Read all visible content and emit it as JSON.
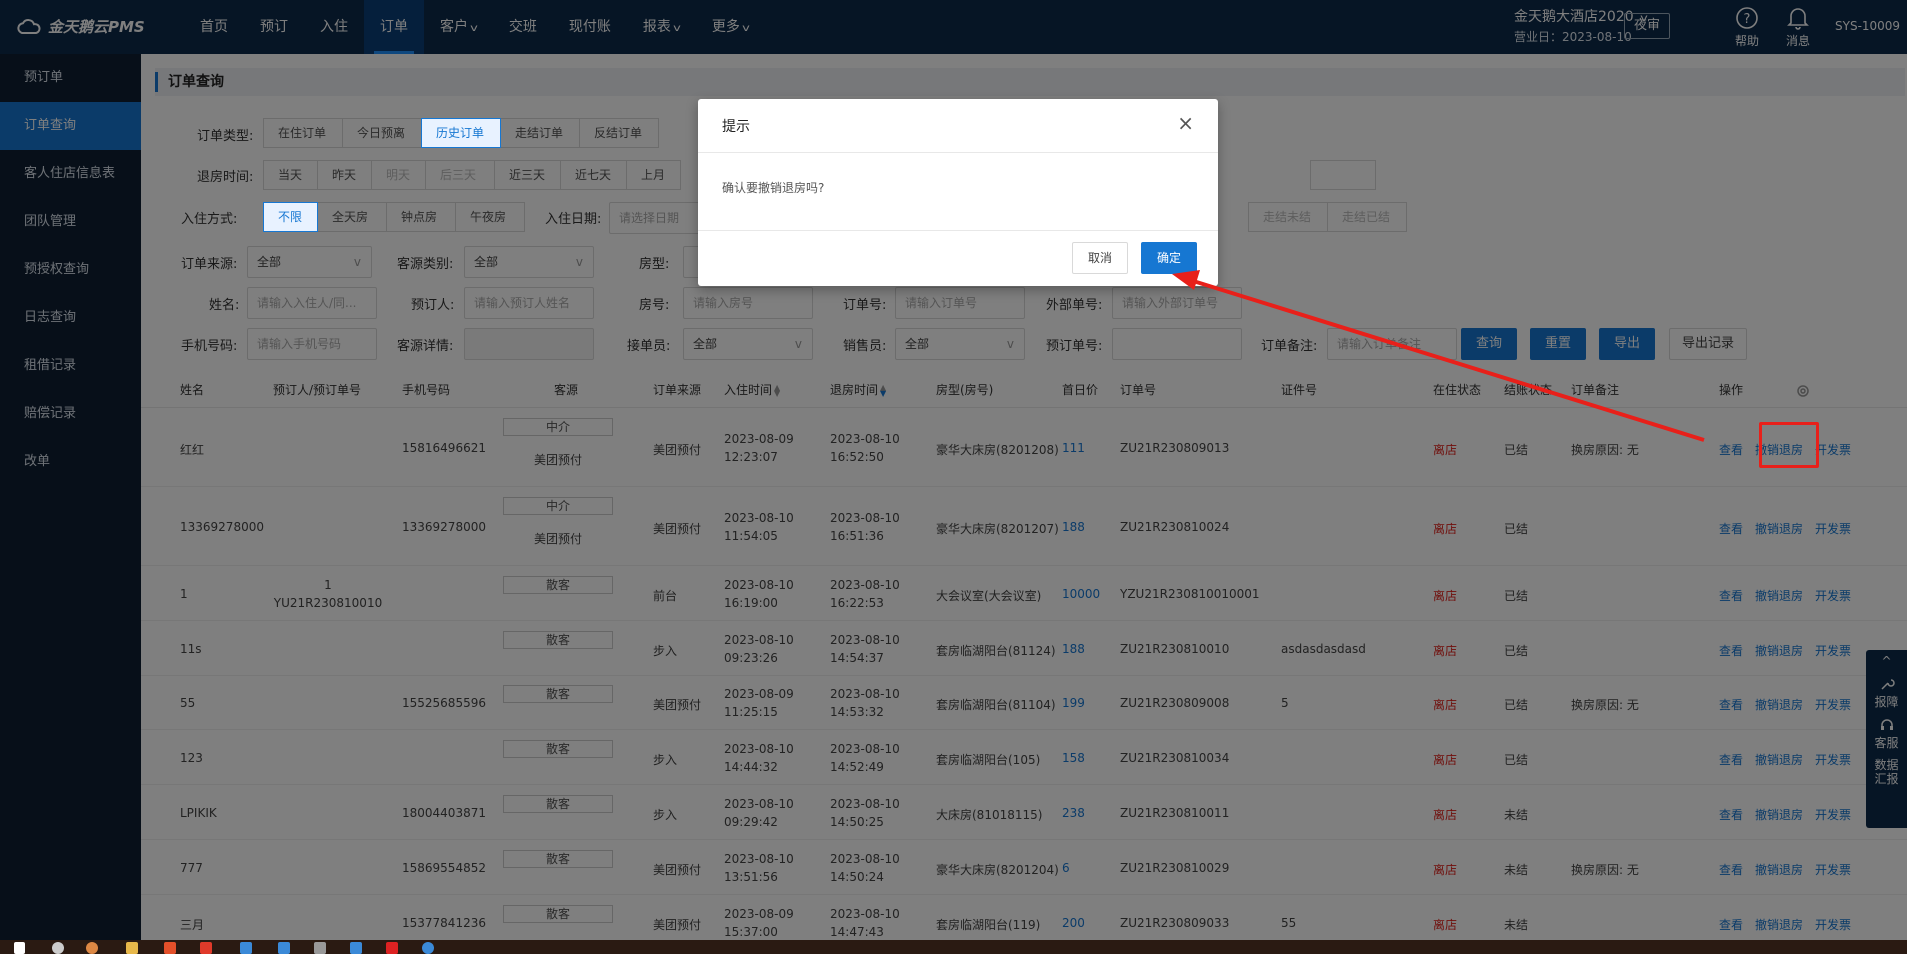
{
  "app": {
    "logo_text": "金天鹅云PMS",
    "nav": [
      {
        "label": "首页",
        "caret": false
      },
      {
        "label": "预订",
        "caret": false
      },
      {
        "label": "入住",
        "caret": false
      },
      {
        "label": "订单",
        "caret": false,
        "active": true
      },
      {
        "label": "客户",
        "caret": true
      },
      {
        "label": "交班",
        "caret": false
      },
      {
        "label": "现付账",
        "caret": false
      },
      {
        "label": "报表",
        "caret": true
      },
      {
        "label": "更多",
        "caret": true
      }
    ],
    "hotel_name": "金天鹅大酒店2020",
    "business_day": "营业日：2023-08-10",
    "night_audit": "夜审",
    "help": "帮助",
    "messages": "消息",
    "user": "SYS-10009",
    "caret_glyph": "v"
  },
  "sidebar": [
    "预订单",
    "订单查询",
    "客人住店信息表",
    "团队管理",
    "预授权查询",
    "日志查询",
    "租借记录",
    "赔偿记录",
    "改单"
  ],
  "panel_title": "订单查询",
  "filters": {
    "order_type_label": "订单类型:",
    "order_types": [
      "在住订单",
      "今日预离",
      "历史订单",
      "走结订单",
      "反结订单"
    ],
    "checkout_time_label": "退房时间:",
    "checkout_times": [
      "当天",
      "昨天",
      "明天",
      "后三天",
      "近三天",
      "近七天",
      "上月"
    ],
    "checkin_mode_label": "入住方式:",
    "checkin_modes": [
      "不限",
      "全天房",
      "钟点房",
      "午夜房"
    ],
    "checkin_date_label": "入住日期:",
    "checkin_date_placeholder": "请选择日期",
    "status_segs": [
      "走结未结",
      "走结已结"
    ],
    "source_label": "订单来源:",
    "source_value": "全部",
    "source_type_label": "客源类别:",
    "source_type_value": "全部",
    "room_type_label": "房型:",
    "name_label": "姓名:",
    "name_placeholder": "请输入入住人/同...",
    "booker_label": "预订人:",
    "booker_placeholder": "请输入预订人姓名",
    "room_no_label": "房号:",
    "room_no_placeholder": "请输入房号",
    "order_no_label": "订单号:",
    "order_no_placeholder": "请输入订单号",
    "ext_no_label": "外部单号:",
    "ext_no_placeholder": "请输入外部订单号",
    "phone_label": "手机号码:",
    "phone_placeholder": "请输入手机号码",
    "source_detail_label": "客源详情:",
    "receiver_label": "接单员:",
    "receiver_value": "全部",
    "sales_label": "销售员:",
    "sales_value": "全部",
    "booking_no_label": "预订单号:",
    "remark_label": "订单备注:",
    "remark_placeholder": "请输入订单备注",
    "query": "查询",
    "reset": "重置",
    "export": "导出",
    "export_log": "导出记录"
  },
  "table": {
    "columns": [
      "姓名",
      "预订人/预订单号",
      "手机号码",
      "客源",
      "订单来源",
      "入住时间",
      "退房时间",
      "房型(房号)",
      "首日价",
      "订单号",
      "证件号",
      "在住状态",
      "结账状态",
      "订单备注",
      "操作"
    ],
    "ops": [
      "查看",
      "撤销退房",
      "开发票"
    ],
    "rows": [
      {
        "name": "红红",
        "booker": "",
        "booker_no": "",
        "phone": "15816496621",
        "tag": "中介",
        "sub": "美团预付",
        "origin": "美团预付",
        "in_d": "2023-08-09",
        "in_t": "12:23:07",
        "out_d": "2023-08-10",
        "out_t": "16:52:50",
        "room": "豪华大床房(8201208)",
        "price": "111",
        "order": "ZU21R230809013",
        "id": "",
        "status": "离店",
        "paid": "已结",
        "remark": "换房原因: 无"
      },
      {
        "name": "13369278000",
        "booker": "",
        "booker_no": "",
        "phone": "13369278000",
        "tag": "中介",
        "sub": "美团预付",
        "origin": "美团预付",
        "in_d": "2023-08-10",
        "in_t": "11:54:05",
        "out_d": "2023-08-10",
        "out_t": "16:51:36",
        "room": "豪华大床房(8201207)",
        "price": "188",
        "order": "ZU21R230810024",
        "id": "",
        "status": "离店",
        "paid": "已结",
        "remark": ""
      },
      {
        "name": "1",
        "booker": "1",
        "booker_no": "YU21R230810010",
        "phone": "",
        "tag": "散客",
        "sub": "",
        "origin": "前台",
        "in_d": "2023-08-10",
        "in_t": "16:19:00",
        "out_d": "2023-08-10",
        "out_t": "16:22:53",
        "room": "大会议室(大会议室)",
        "price": "10000",
        "order": "YZU21R230810010001",
        "id": "",
        "status": "离店",
        "paid": "已结",
        "remark": ""
      },
      {
        "name": "11s",
        "booker": "",
        "booker_no": "",
        "phone": "",
        "tag": "散客",
        "sub": "",
        "origin": "步入",
        "in_d": "2023-08-10",
        "in_t": "09:23:26",
        "out_d": "2023-08-10",
        "out_t": "14:54:37",
        "room": "套房临湖阳台(81124)",
        "price": "188",
        "order": "ZU21R230810010",
        "id": "asdasdasdasd",
        "status": "离店",
        "paid": "已结",
        "remark": ""
      },
      {
        "name": "55",
        "booker": "",
        "booker_no": "",
        "phone": "15525685596",
        "tag": "散客",
        "sub": "",
        "origin": "美团预付",
        "in_d": "2023-08-09",
        "in_t": "11:25:15",
        "out_d": "2023-08-10",
        "out_t": "14:53:32",
        "room": "套房临湖阳台(81104)",
        "price": "199",
        "order": "ZU21R230809008",
        "id": "5",
        "status": "离店",
        "paid": "已结",
        "remark": "换房原因: 无"
      },
      {
        "name": "123",
        "booker": "",
        "booker_no": "",
        "phone": "",
        "tag": "散客",
        "sub": "",
        "origin": "步入",
        "in_d": "2023-08-10",
        "in_t": "14:44:32",
        "out_d": "2023-08-10",
        "out_t": "14:52:49",
        "room": "套房临湖阳台(105)",
        "price": "158",
        "order": "ZU21R230810034",
        "id": "",
        "status": "离店",
        "paid": "已结",
        "remark": ""
      },
      {
        "name": "LPIKIK",
        "booker": "",
        "booker_no": "",
        "phone": "18004403871",
        "tag": "散客",
        "sub": "",
        "origin": "步入",
        "in_d": "2023-08-10",
        "in_t": "09:29:42",
        "out_d": "2023-08-10",
        "out_t": "14:50:25",
        "room": "大床房(81018115)",
        "price": "238",
        "order": "ZU21R230810011",
        "id": "",
        "status": "离店",
        "paid": "未结",
        "remark": ""
      },
      {
        "name": "777",
        "booker": "",
        "booker_no": "",
        "phone": "15869554852",
        "tag": "散客",
        "sub": "",
        "origin": "美团预付",
        "in_d": "2023-08-10",
        "in_t": "13:51:56",
        "out_d": "2023-08-10",
        "out_t": "14:50:24",
        "room": "豪华大床房(8201204)",
        "price": "6",
        "order": "ZU21R230810029",
        "id": "",
        "status": "离店",
        "paid": "未结",
        "remark": "换房原因: 无"
      },
      {
        "name": "三月",
        "booker": "",
        "booker_no": "",
        "phone": "15377841236",
        "tag": "散客",
        "sub": "",
        "origin": "美团预付",
        "in_d": "2023-08-09",
        "in_t": "15:37:00",
        "out_d": "2023-08-10",
        "out_t": "14:47:43",
        "room": "套房临湖阳台(119)",
        "price": "200",
        "order": "ZU21R230809033",
        "id": "55",
        "status": "离店",
        "paid": "未结",
        "remark": ""
      }
    ]
  },
  "float_bar": [
    "报障",
    "客服",
    "数据汇报"
  ],
  "modal": {
    "title": "提示",
    "close": "×",
    "message": "确认要撤销退房吗?",
    "cancel": "取消",
    "ok": "确定"
  },
  "annotation_color": "#e8201a",
  "accent": "#1677d2"
}
